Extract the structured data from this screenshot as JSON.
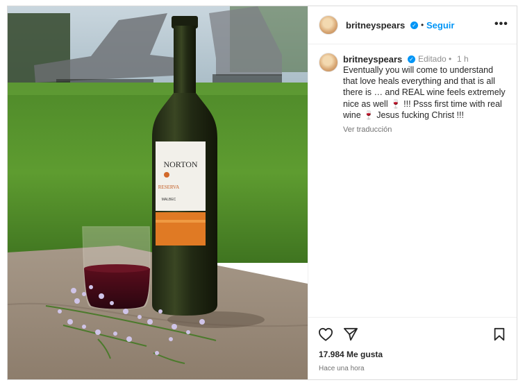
{
  "post": {
    "username": "britneyspears",
    "follow_label": "Seguir",
    "more_label": "•••",
    "edited_label": "Editado",
    "time_ago": "1 h",
    "caption": "Eventually you will come to understand that love heals everything and that is all there is … and REAL wine feels extremely nice as well 🍷 !!! Psss first time with real wine 🍷 Jesus fucking Christ !!!",
    "translate_label": "Ver traducción",
    "likes": "17.984 Me gusta",
    "posted_time": "Hace una hora"
  },
  "photo": {
    "bottle_brand": "NORTON",
    "bottle_line": "RESERVA",
    "bottle_variety": "MALBEC"
  },
  "icons": {
    "like": "heart-icon",
    "share": "send-icon",
    "save": "bookmark-icon",
    "verified": "verified-badge-icon",
    "more": "more-options-icon"
  },
  "colors": {
    "accent": "#0095f6",
    "text": "#262626",
    "muted": "#8e8e8e"
  }
}
